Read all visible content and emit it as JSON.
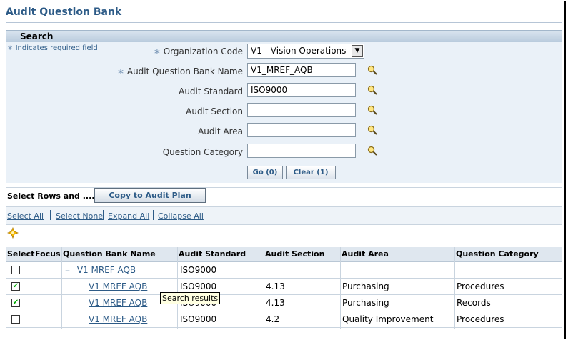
{
  "page": {
    "title": "Audit Question Bank"
  },
  "search": {
    "header": "Search",
    "required_note": "Indicates required field",
    "fields": {
      "org_code_label": "Organization Code",
      "org_code_value": "V1 - Vision Operations",
      "bank_name_label": "Audit Question Bank Name",
      "bank_name_value": "V1_MREF_AQB",
      "standard_label": "Audit Standard",
      "standard_value": "ISO9000",
      "section_label": "Audit Section",
      "section_value": "",
      "area_label": "Audit Area",
      "area_value": "",
      "category_label": "Question Category",
      "category_value": ""
    },
    "go_label": "Go (0)",
    "clear_label": "Clear (1)"
  },
  "actions": {
    "select_rows_label": "Select Rows and ....",
    "copy_label": "Copy to Audit Plan",
    "links": [
      "Select All",
      "Select None",
      "Expand All",
      "Collapse All"
    ]
  },
  "table": {
    "headers": [
      "Select",
      "Focus",
      "Question Bank Name",
      "Audit Standard",
      "Audit Section",
      "Audit Area",
      "Question Category"
    ],
    "rows": [
      {
        "name": "V1 MREF AQB",
        "standard": "ISO9000",
        "section": "",
        "area": "",
        "category": "",
        "checked": false,
        "parent": true
      },
      {
        "name": "V1 MREF AQB",
        "standard": "ISO9000",
        "section": "4.13",
        "area": "Purchasing",
        "category": "Procedures",
        "checked": true,
        "parent": false
      },
      {
        "name": "V1 MREF AQB",
        "standard": "ISO9000",
        "section": "4.13",
        "area": "Purchasing",
        "category": "Records",
        "checked": true,
        "parent": false
      },
      {
        "name": "V1 MREF AQB",
        "standard": "ISO9000",
        "section": "4.2",
        "area": "Quality Improvement",
        "category": "Procedures",
        "checked": false,
        "parent": false
      }
    ]
  },
  "tooltip": "Search results",
  "colors": {
    "title": "#2d5b87",
    "panel": "#eaf1f8",
    "header_bar": "#b9cbdd"
  }
}
